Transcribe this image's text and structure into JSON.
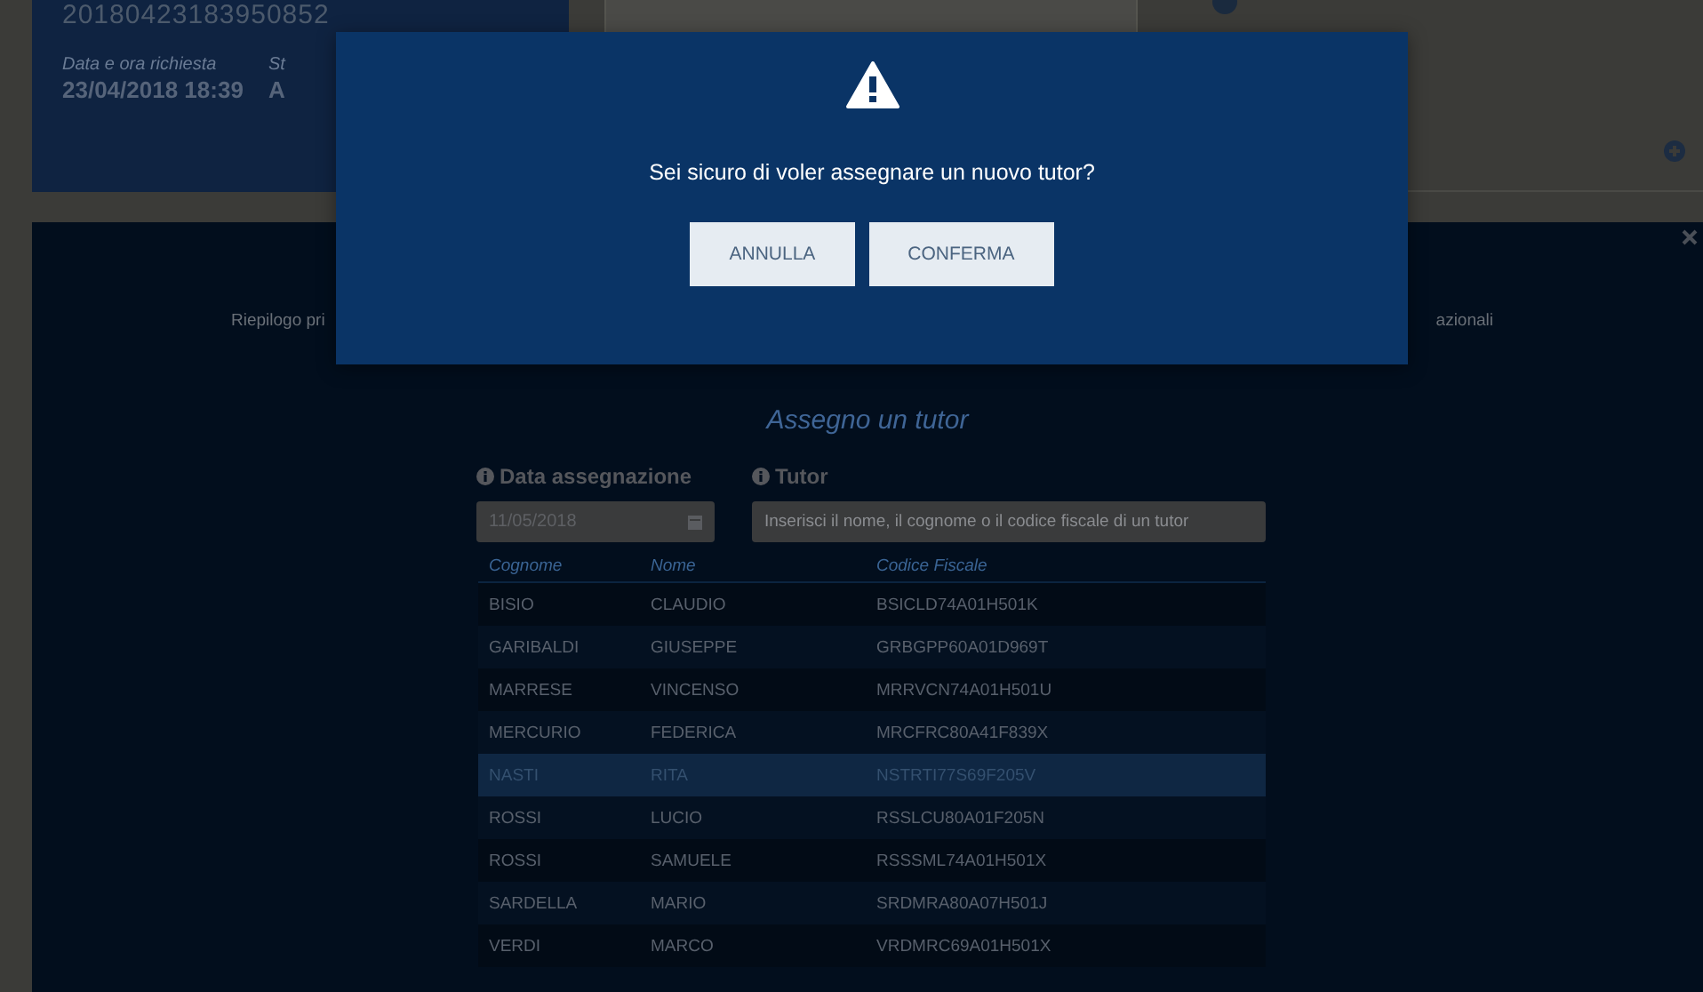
{
  "request_card": {
    "id": "20180423183950852",
    "fields": [
      {
        "label": "Data e ora richiesta",
        "value": "23/04/2018 18:39"
      },
      {
        "label": "St",
        "value": "A"
      }
    ]
  },
  "panel": {
    "section_links": [
      "Riepilogo pri",
      "azionali"
    ],
    "title": "Assegno un tutor",
    "date_label": "Data assegnazione",
    "date_value": "11/05/2018",
    "tutor_label": "Tutor",
    "tutor_placeholder": "Inserisci il nome, il cognome o il codice fiscale di un tutor"
  },
  "table": {
    "columns": [
      "Cognome",
      "Nome",
      "Codice Fiscale"
    ],
    "rows": [
      {
        "cells": [
          "BISIO",
          "CLAUDIO",
          "BSICLD74A01H501K"
        ],
        "selected": false
      },
      {
        "cells": [
          "GARIBALDI",
          "GIUSEPPE",
          "GRBGPP60A01D969T"
        ],
        "selected": false
      },
      {
        "cells": [
          "MARRESE",
          "VINCENSO",
          "MRRVCN74A01H501U"
        ],
        "selected": false
      },
      {
        "cells": [
          "MERCURIO",
          "FEDERICA",
          "MRCFRC80A41F839X"
        ],
        "selected": false
      },
      {
        "cells": [
          "NASTI",
          "RITA",
          "NSTRTI77S69F205V"
        ],
        "selected": true
      },
      {
        "cells": [
          "ROSSI",
          "LUCIO",
          "RSSLCU80A01F205N"
        ],
        "selected": false
      },
      {
        "cells": [
          "ROSSI",
          "SAMUELE",
          "RSSSML74A01H501X"
        ],
        "selected": false
      },
      {
        "cells": [
          "SARDELLA",
          "MARIO",
          "SRDMRA80A07H501J"
        ],
        "selected": false
      },
      {
        "cells": [
          "VERDI",
          "MARCO",
          "VRDMRC69A01H501X"
        ],
        "selected": false
      }
    ]
  },
  "dialog": {
    "message": "Sei sicuro di voler assegnare un nuovo tutor?",
    "buttons": [
      "ANNULLA",
      "CONFERMA"
    ]
  }
}
